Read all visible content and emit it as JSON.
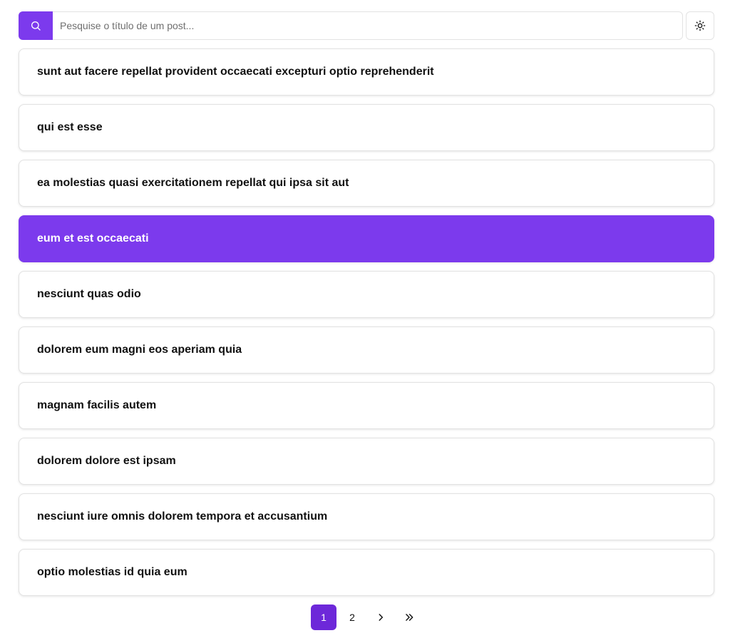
{
  "search": {
    "placeholder": "Pesquise o título de um post...",
    "value": ""
  },
  "posts": [
    {
      "title": "sunt aut facere repellat provident occaecati excepturi optio reprehenderit",
      "active": false
    },
    {
      "title": "qui est esse",
      "active": false
    },
    {
      "title": "ea molestias quasi exercitationem repellat qui ipsa sit aut",
      "active": false
    },
    {
      "title": "eum et est occaecati",
      "active": true
    },
    {
      "title": "nesciunt quas odio",
      "active": false
    },
    {
      "title": "dolorem eum magni eos aperiam quia",
      "active": false
    },
    {
      "title": "magnam facilis autem",
      "active": false
    },
    {
      "title": "dolorem dolore est ipsam",
      "active": false
    },
    {
      "title": "nesciunt iure omnis dolorem tempora et accusantium",
      "active": false
    },
    {
      "title": "optio molestias id quia eum",
      "active": false
    }
  ],
  "pagination": {
    "pages": [
      "1",
      "2"
    ],
    "current": "1",
    "next_icon": "chevron-right-icon",
    "last_icon": "chevrons-right-icon"
  },
  "colors": {
    "accent": "#7c3aed",
    "accent_dark": "#6d28d9",
    "border": "#e2e2e2"
  },
  "icons": {
    "search": "search-icon",
    "theme": "sun-icon"
  }
}
